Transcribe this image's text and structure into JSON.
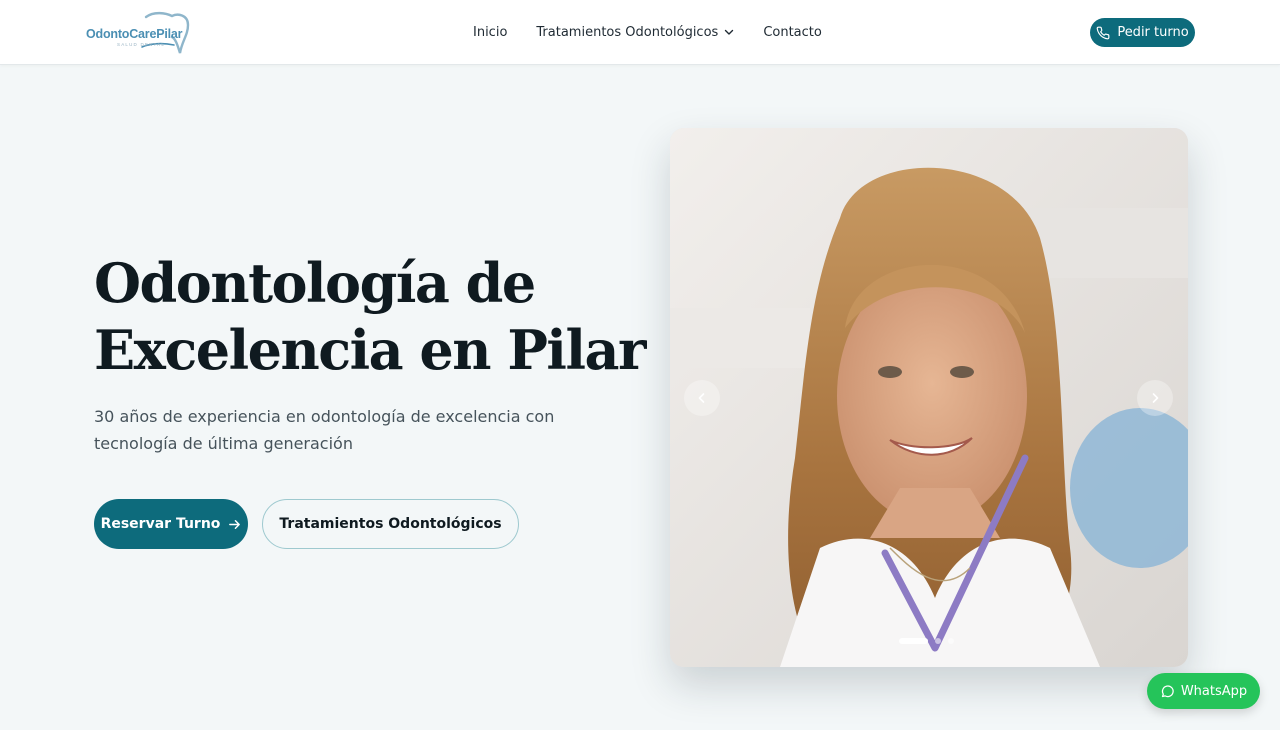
{
  "header": {
    "logo": {
      "name": "OdontoCarePilar",
      "tagline": "SALUD DENTAL"
    },
    "nav": [
      {
        "label": "Inicio"
      },
      {
        "label": "Tratamientos Odontológicos",
        "has_dropdown": true
      },
      {
        "label": "Contacto"
      }
    ],
    "cta_label": "Pedir turno"
  },
  "hero": {
    "title_line1": "Odontología de",
    "title_line2": "Excelencia en Pilar",
    "subtitle": "30 años de experiencia en odontología de excelencia con tecnología de última generación",
    "primary_button": "Reservar Turno",
    "secondary_button": "Tratamientos Odontológicos"
  },
  "carousel": {
    "slide_count": 3,
    "active_slide": 1
  },
  "whatsapp": {
    "label": "WhatsApp"
  },
  "colors": {
    "brand": "#0d6b7c",
    "whatsapp": "#25c45a",
    "background": "#f3f7f8"
  },
  "icons": {
    "phone": "phone-icon",
    "dropdown": "chevron-down-icon",
    "arrow": "arrow-right-icon",
    "prev": "chevron-left-icon",
    "next": "chevron-right-icon",
    "whatsapp": "whatsapp-icon"
  }
}
